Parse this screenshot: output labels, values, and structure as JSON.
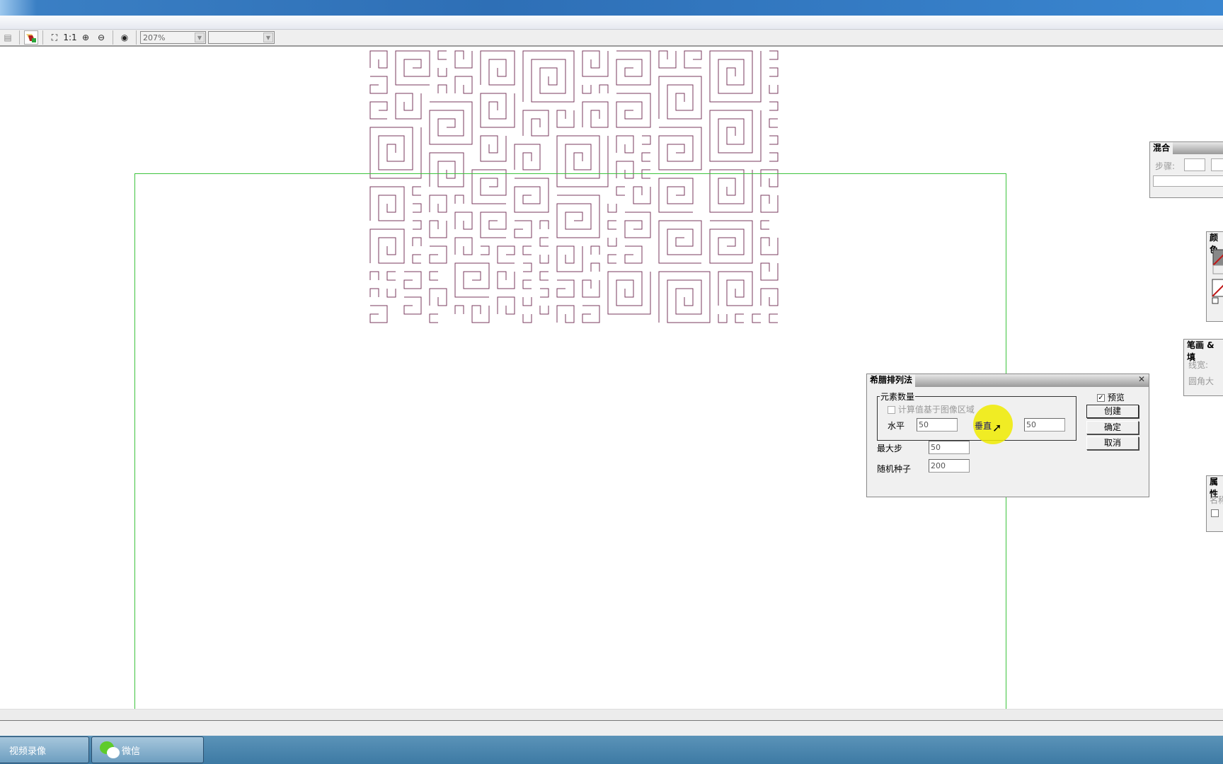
{
  "toolbar": {
    "zoom_value": "207%",
    "second_combo": "",
    "items": [
      "select-icon",
      "fit-icon",
      "1:1",
      "zoom-in-icon",
      "zoom-out-icon",
      "zoom-prev-icon"
    ]
  },
  "canvas": {
    "pattern_color": "#7a3a5e",
    "guide_color": "#3ec43e"
  },
  "dialog": {
    "title": "希腊排列法",
    "group_label": "元素数量",
    "calc_checkbox_label": "计算值基于图像区域",
    "calc_checked": false,
    "horizontal_label": "水平",
    "horizontal_value": "50",
    "vertical_label": "垂直",
    "vertical_value": "50",
    "max_step_label": "最大步",
    "max_step_value": "50",
    "seed_label": "随机种子",
    "seed_value": "200",
    "preview_label": "预览",
    "preview_checked": true,
    "create_label": "创建",
    "ok_label": "确定",
    "cancel_label": "取消"
  },
  "panels": {
    "blend": {
      "title": "混合",
      "step_label": "步骤:"
    },
    "color": {
      "title": "颜色"
    },
    "stroke": {
      "title": "笔画 & 填",
      "width_label": "线宽:",
      "corner_label": "圆角大"
    },
    "props": {
      "title": "属性",
      "name_label": "名称"
    }
  },
  "taskbar": {
    "items": [
      {
        "label": "视频录像"
      },
      {
        "label": "微信"
      }
    ]
  }
}
